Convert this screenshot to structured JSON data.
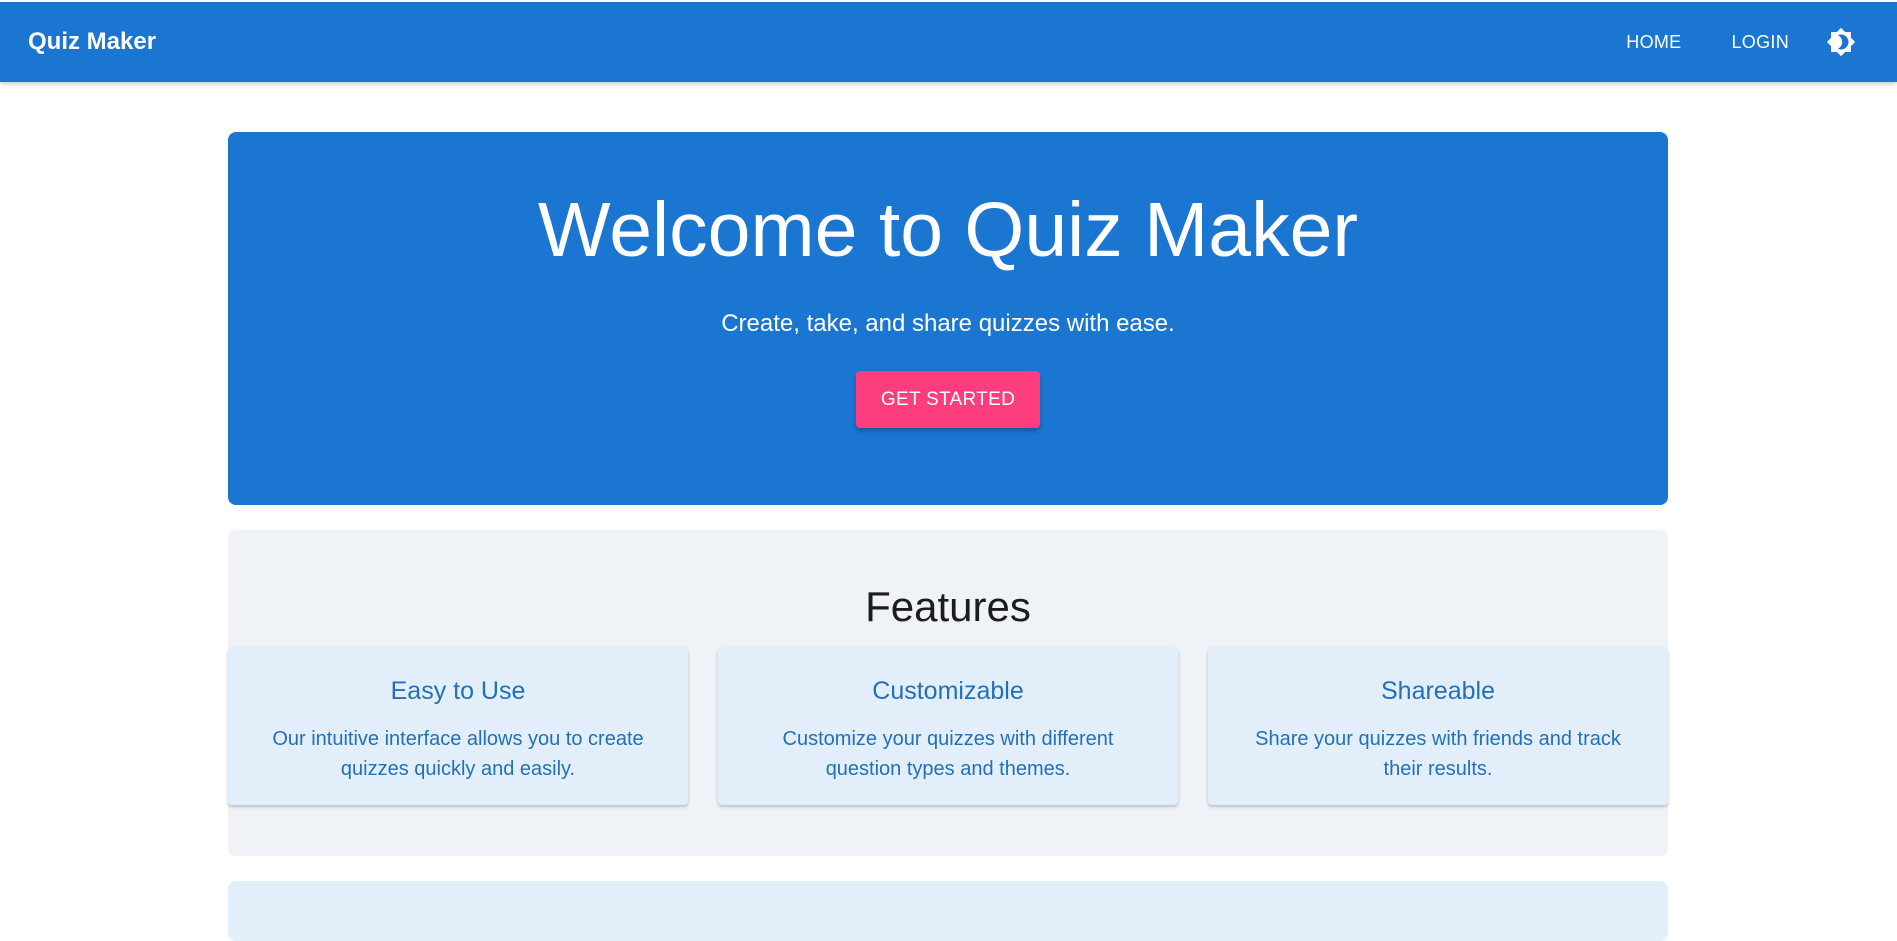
{
  "appbar": {
    "brand": "Quiz Maker",
    "nav": {
      "home_label": "HOME",
      "login_label": "LOGIN"
    },
    "theme_icon": "brightness-icon",
    "color": "#1b76d2"
  },
  "hero": {
    "title": "Welcome to Quiz Maker",
    "subtitle": "Create, take, and share quizzes with ease.",
    "cta_label": "GET STARTED",
    "cta_color": "#fe3d7e"
  },
  "features": {
    "title": "Features",
    "cards": [
      {
        "title": "Easy to Use",
        "text": "Our intuitive interface allows you to create quizzes quickly and easily."
      },
      {
        "title": "Customizable",
        "text": "Customize your quizzes with different question types and themes."
      },
      {
        "title": "Shareable",
        "text": "Share your quizzes with friends and track their results."
      }
    ]
  }
}
